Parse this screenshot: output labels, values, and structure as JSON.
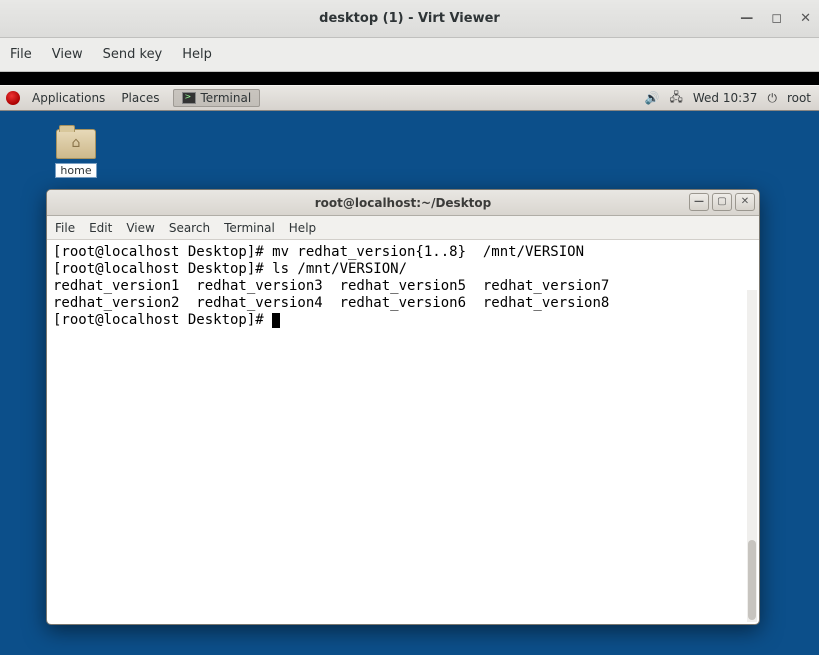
{
  "virt": {
    "title": "desktop (1) - Virt Viewer",
    "menu": {
      "file": "File",
      "view": "View",
      "sendkey": "Send key",
      "help": "Help"
    }
  },
  "gnome": {
    "applications": "Applications",
    "places": "Places",
    "task_terminal": "Terminal",
    "time": "Wed 10:37",
    "user": "root"
  },
  "desktop": {
    "home_label": "home"
  },
  "terminal": {
    "title": "root@localhost:~/Desktop",
    "menu": {
      "file": "File",
      "edit": "Edit",
      "view": "View",
      "search": "Search",
      "terminal": "Terminal",
      "help": "Help"
    },
    "lines": [
      "[root@localhost Desktop]# mv redhat_version{1..8}  /mnt/VERSION",
      "[root@localhost Desktop]# ls /mnt/VERSION/",
      "redhat_version1  redhat_version3  redhat_version5  redhat_version7",
      "redhat_version2  redhat_version4  redhat_version6  redhat_version8"
    ],
    "prompt": "[root@localhost Desktop]# "
  }
}
